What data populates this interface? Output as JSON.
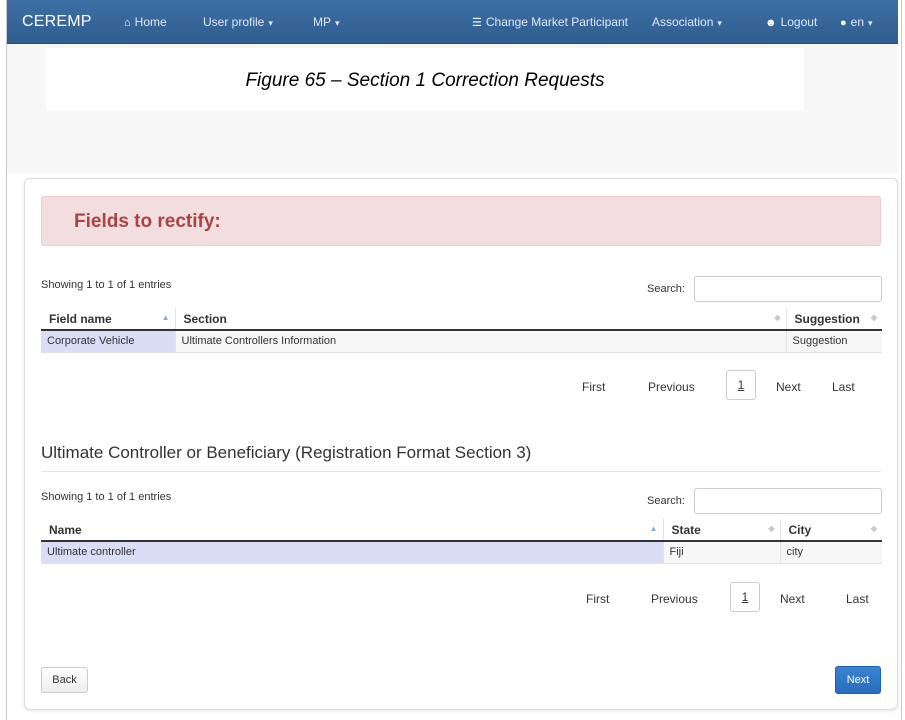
{
  "navbar": {
    "brand": "CEREMP",
    "home": "Home",
    "user_profile": "User profile",
    "mp": "MP",
    "change_mp": "Change Market Participant",
    "association": "Association",
    "logout": "Logout",
    "lang": "en",
    "caret": "▾"
  },
  "caption": "Figure 65 – Section 1 Correction Requests",
  "alert": {
    "title": "Fields to rectify:"
  },
  "table1": {
    "info": "Showing 1 to 1 of 1 entries",
    "search_label": "Search:",
    "columns": [
      "Field name",
      "Section",
      "Suggestion"
    ],
    "rows": [
      {
        "field_name": "Corporate Vehicle",
        "section": "Ultimate Controllers Information",
        "suggestion": "Suggestion"
      }
    ]
  },
  "pagination1": {
    "first": "First",
    "previous": "Previous",
    "page": "1",
    "next": "Next",
    "last": "Last"
  },
  "section2": {
    "heading": "Ultimate Controller or Beneficiary (Registration Format Section 3)"
  },
  "table2": {
    "info": "Showing 1 to 1 of 1 entries",
    "search_label": "Search:",
    "columns": [
      "Name",
      "State",
      "City"
    ],
    "rows": [
      {
        "name": "Ultimate controller",
        "state": "Fiji",
        "city": "city"
      }
    ]
  },
  "pagination2": {
    "first": "First",
    "previous": "Previous",
    "page": "1",
    "next": "Next",
    "last": "Last"
  },
  "buttons": {
    "back": "Back",
    "next": "Next"
  },
  "icons": {
    "home": "home-icon",
    "change_mp": "list-icon",
    "logout": "user-icon",
    "lang": "globe-icon"
  },
  "colors": {
    "navbar": "#3e6fa4",
    "alert_bg": "#f2dede",
    "alert_text": "#a94442",
    "primary": "#2a6cbd",
    "selected_row": "#d9ddf5"
  }
}
